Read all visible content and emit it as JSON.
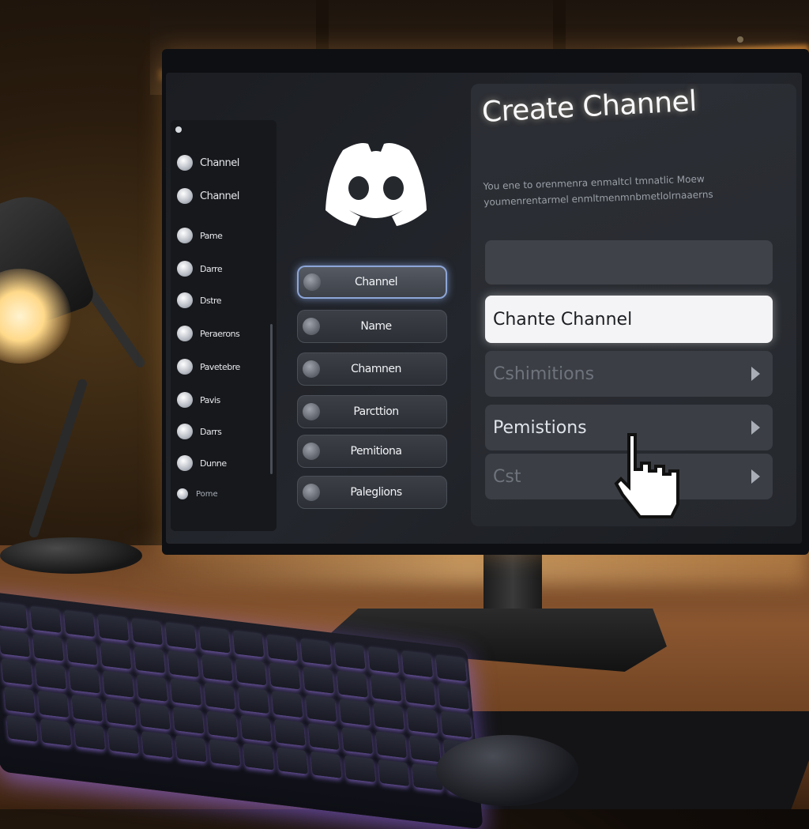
{
  "sidebar": {
    "header": "",
    "items": [
      {
        "label": "Channel",
        "icon": "circle-icon"
      },
      {
        "label": "Channel",
        "icon": "circle-icon"
      },
      {
        "label": "Pame",
        "icon": "circle-icon"
      },
      {
        "label": "Darre",
        "icon": "circle-icon"
      },
      {
        "label": "Dstre",
        "icon": "circle-icon"
      },
      {
        "label": "Peraerons",
        "icon": "circle-icon"
      },
      {
        "label": "Pavetebre",
        "icon": "circle-icon"
      },
      {
        "label": "Pavis",
        "icon": "circle-icon"
      },
      {
        "label": "Darrs",
        "icon": "circle-icon"
      },
      {
        "label": "Dunne",
        "icon": "circle-icon"
      }
    ],
    "footer": "Pome"
  },
  "middle": {
    "logo": "discord-logo-icon",
    "buttons": [
      {
        "label": "Channel",
        "active": true
      },
      {
        "label": "Name",
        "active": false
      },
      {
        "label": "Chamnen",
        "active": false
      },
      {
        "label": "Parcttion",
        "active": false
      },
      {
        "label": "Pemitiona",
        "active": false
      },
      {
        "label": "Paleglions",
        "active": false
      }
    ]
  },
  "panel": {
    "title": "Create Channel",
    "description_line1": "You ene to orenmenra enmaltcl tmnatlic Moew",
    "description_line2": "youmenrentarmel enmltmenmnbmetlolrnaaerns",
    "input_value": "",
    "options": [
      {
        "label": "Chante Channel",
        "selected": true,
        "chevron": false
      },
      {
        "label": "Cshimitions",
        "selected": false,
        "chevron": true,
        "faded": true
      },
      {
        "label": "Pemistions",
        "selected": false,
        "chevron": true,
        "faded": false
      },
      {
        "label": "Cst",
        "selected": false,
        "chevron": true,
        "faded": true
      }
    ]
  },
  "colors": {
    "accent_glow": "#8da6d8",
    "panel_bg": "#2c2f35",
    "keyboard_glow": "#a882ff",
    "lamp_light": "#ffd98a"
  }
}
